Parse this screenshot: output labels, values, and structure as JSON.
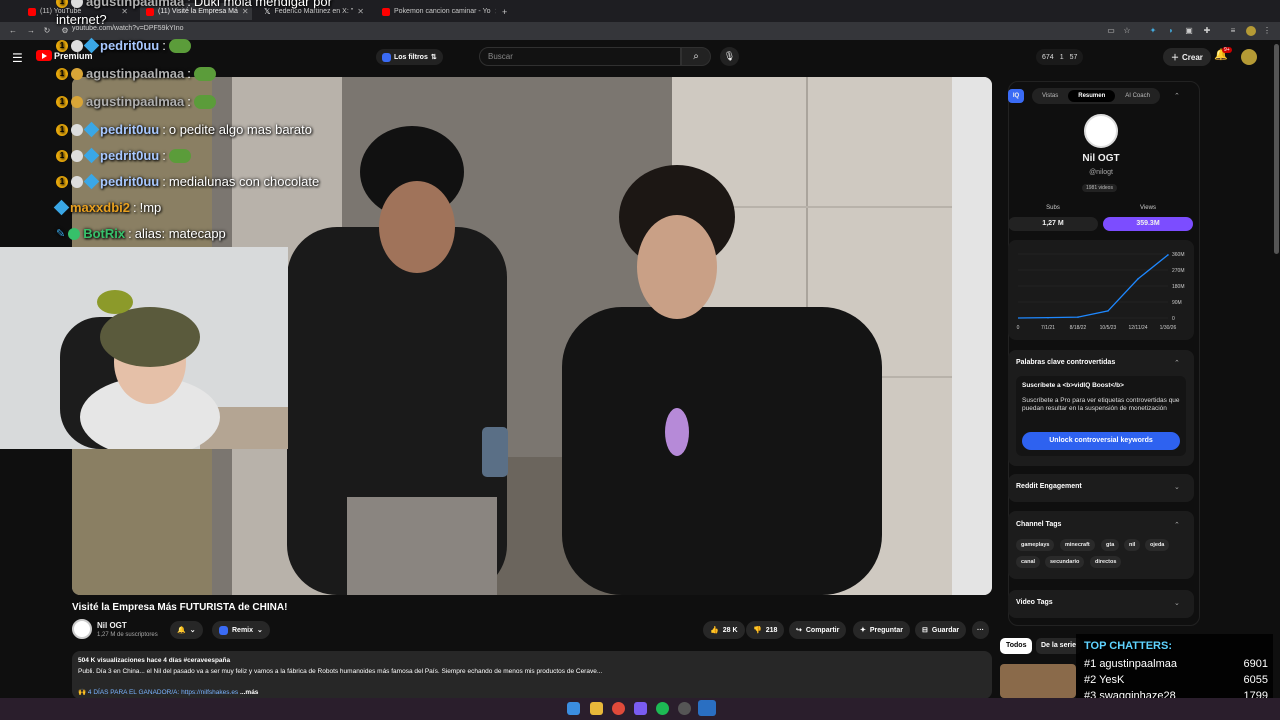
{
  "browser": {
    "tabs": [
      {
        "label": "(11) YouTube"
      },
      {
        "label": "(11) Visité la Empresa Má"
      },
      {
        "label": "Federico Martinez en X: \""
      },
      {
        "label": "Pokemon cancion caminar - Yo"
      }
    ],
    "new_tab": "+",
    "url": "youtube.com/watch?v=DPF59kYIno"
  },
  "youtube": {
    "premium_label": "Premium",
    "filters_label": "Los filtros",
    "search_placeholder": "Buscar",
    "stats": {
      "a": "674",
      "b": "1",
      "c": "57"
    },
    "create_label": "Crear",
    "notif_count": "9+"
  },
  "chat_overlay": {
    "lines": [
      {
        "user": "agustinpaalmaa",
        "msg": "Duki mola mendigar por"
      },
      {
        "user": "",
        "msg": "internet?"
      },
      {
        "user": "pedrit0uu",
        "msg": ""
      },
      {
        "user": "agustinpaalmaa",
        "msg": ""
      },
      {
        "user": "agustinpaalmaa",
        "msg": ""
      },
      {
        "user": "pedrit0uu",
        "msg": "o pedite algo mas barato"
      },
      {
        "user": "pedrit0uu",
        "msg": ""
      },
      {
        "user": "pedrit0uu",
        "msg": "medialunas con chocolate"
      },
      {
        "user": "maxxdbi2",
        "msg": "!mp"
      },
      {
        "user": "BotRix",
        "msg": "alias: matecapp"
      }
    ]
  },
  "video": {
    "title": "Visité la Empresa Más FUTURISTA de CHINA!",
    "channel": "Nil OGT",
    "subscribers": "1,27 M de suscriptores",
    "remix_label": "Remix",
    "likes": "28 K",
    "dislikes": "218",
    "share_label": "Compartir",
    "ask_label": "Preguntar",
    "save_label": "Guardar",
    "more_label": "···",
    "description": {
      "meta": "504 K visualizaciones  hace 4 días  #ceraveespaña",
      "body": "Publi. Día 3 en China... el Nil del pasado va a ser muy feliz y vamos a la fábrica de Robots humanoides más famosa del País. Siempre echando de menos mis productos de Cerave...",
      "promo": "🙌 4 DÍAS PARA EL GANADOR/A: https://nilfshakes.es",
      "more": "...más"
    }
  },
  "vidiq": {
    "logo": "IQ",
    "tabs": [
      "Vistas",
      "Resumen",
      "AI Coach"
    ],
    "active_tab": "Resumen",
    "channel_name": "Nil OGT",
    "handle": "@nilogt",
    "videos": "1981 videos",
    "subs_label": "Subs",
    "views_label": "Views",
    "subs_value": "1,27 M",
    "views_value": "359.3M",
    "controversial_title": "Palabras clave controvertidas",
    "boost_title": "Suscríbete a <b>vidIQ Boost</b>",
    "boost_text": "Suscríbete a Pro para ver etiquetas controvertidas que puedan resultar en la suspensión de monetización",
    "unlock_label": "Unlock controversial keywords",
    "reddit_title": "Reddit Engagement",
    "channel_tags_title": "Channel Tags",
    "tags": [
      "gameplays",
      "minecraft",
      "gta",
      "nil",
      "ojeda",
      "canal",
      "secundario",
      "directos"
    ],
    "video_tags_title": "Video Tags"
  },
  "chart_data": {
    "type": "line",
    "x": [
      "7/1/21",
      "8/18/22",
      "10/5/23",
      "12/11/24",
      "1/30/26"
    ],
    "xtick_labels": [
      "0",
      "7/1/21",
      "8/18/22",
      "10/5/23",
      "12/11/24",
      "1/30/26"
    ],
    "ytick_labels": [
      "0",
      "90M",
      "180M",
      "270M",
      "360M"
    ],
    "ylim": [
      0,
      360
    ],
    "series": [
      {
        "values": [
          2,
          5,
          40,
          220,
          355
        ]
      }
    ]
  },
  "recommendations": {
    "filter_all": "Todos",
    "filter_series": "De la serie"
  },
  "top_chatters": {
    "title": "TOP CHATTERS:",
    "rows": [
      {
        "rank": "#1",
        "name": "agustinpaalmaa",
        "count": "6901"
      },
      {
        "rank": "#2",
        "name": "YesK",
        "count": "6055"
      },
      {
        "rank": "#3",
        "name": "swagginhaze28",
        "count": "1799"
      }
    ]
  },
  "colors": {
    "yt_red": "#ff0000",
    "vidiq_purple": "#7c4dff",
    "vidiq_blue": "#2e62f0",
    "chart_line": "#1e88ff",
    "chatters_title": "#5fd3ff"
  }
}
